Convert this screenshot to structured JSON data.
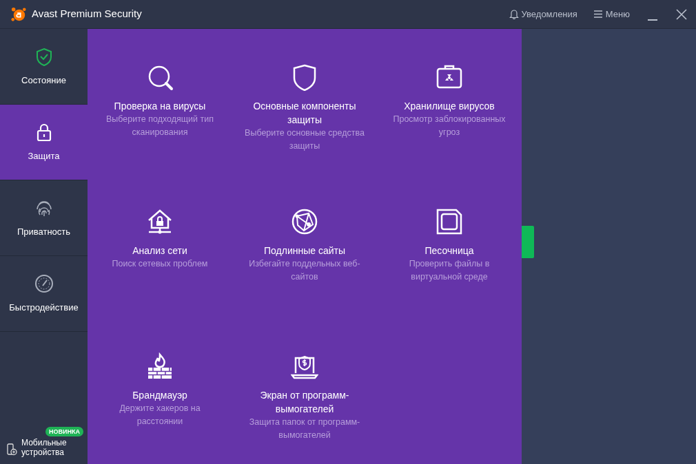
{
  "window": {
    "title": "Avast Premium Security",
    "notifications": "Уведомления",
    "menu": "Меню"
  },
  "sidebar": {
    "items": [
      {
        "label": "Состояние",
        "selected": false
      },
      {
        "label": "Защита",
        "selected": true
      },
      {
        "label": "Приватность",
        "selected": false
      },
      {
        "label": "Быстродействие",
        "selected": false
      }
    ],
    "mobile": {
      "label": "Мобильные устройства",
      "badge": "НОВИНКА"
    }
  },
  "tiles": [
    {
      "title": "Проверка на вирусы",
      "subtitle": "Выберите подходящий тип сканирования"
    },
    {
      "title": "Основные компоненты защиты",
      "subtitle": "Выберите основные средства защиты"
    },
    {
      "title": "Хранилище вирусов",
      "subtitle": "Просмотр заблокированных угроз"
    },
    {
      "title": "Анализ сети",
      "subtitle": "Поиск сетевых проблем"
    },
    {
      "title": "Подлинные сайты",
      "subtitle": "Избегайте поддельных веб-сайтов"
    },
    {
      "title": "Песочница",
      "subtitle": "Проверить файлы в виртуальной среде"
    },
    {
      "title": "Брандмауэр",
      "subtitle": "Держите хакеров на расстоянии"
    },
    {
      "title": "Экран от программ-вымогателей",
      "subtitle": "Защита папок от программ-вымогателей"
    }
  ]
}
